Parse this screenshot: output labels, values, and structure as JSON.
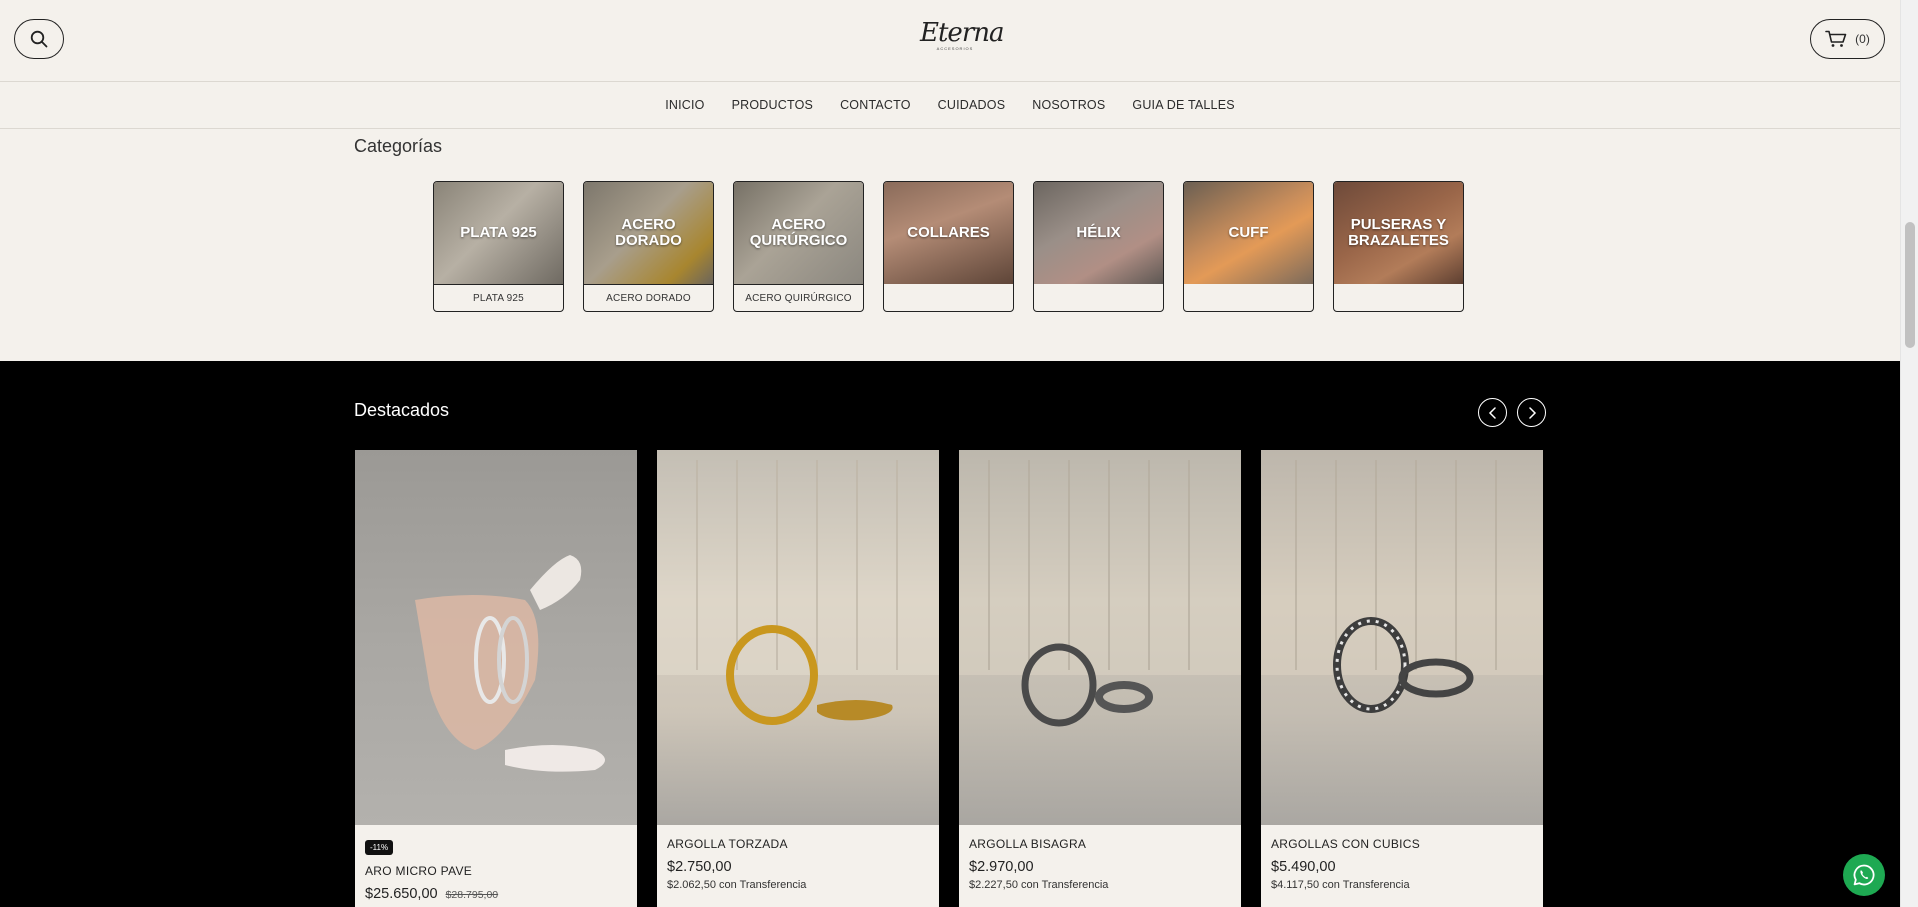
{
  "header": {
    "logo_text": "Eterna",
    "logo_subtext": "ACCESORIOS",
    "cart_count": "(0)"
  },
  "nav": {
    "items": [
      "INICIO",
      "PRODUCTOS",
      "CONTACTO",
      "CUIDADOS",
      "NOSOTROS",
      "GUIA DE TALLES"
    ]
  },
  "categories": {
    "title": "Categorías",
    "items": [
      {
        "image_text": "PLATA 925",
        "label": "PLATA 925"
      },
      {
        "image_text": "ACERO DORADO",
        "label": "ACERO DORADO"
      },
      {
        "image_text": "ACERO QUIRÚRGICO",
        "label": "ACERO QUIRÚRGICO"
      },
      {
        "image_text": "COLLARES",
        "label": ""
      },
      {
        "image_text": "HÉLIX",
        "label": ""
      },
      {
        "image_text": "CUFF",
        "label": ""
      },
      {
        "image_text": "PULSERAS Y BRAZALETES",
        "label": ""
      }
    ]
  },
  "featured": {
    "title": "Destacados",
    "products": [
      {
        "badge": "-11%",
        "name": "ARO MICRO PAVE",
        "price": "$25.650,00",
        "old_price": "$28.795,00",
        "transfer": ""
      },
      {
        "badge": "",
        "name": "ARGOLLA TORZADA",
        "price": "$2.750,00",
        "old_price": "",
        "transfer": "$2.062,50 con Transferencia"
      },
      {
        "badge": "",
        "name": "ARGOLLA BISAGRA",
        "price": "$2.970,00",
        "old_price": "",
        "transfer": "$2.227,50 con Transferencia"
      },
      {
        "badge": "",
        "name": "ARGOLLAS CON CUBICS",
        "price": "$5.490,00",
        "old_price": "",
        "transfer": "$4.117,50 con Transferencia"
      }
    ]
  },
  "colors": {
    "background": "#f4f1ec",
    "featured_bg": "#000000",
    "whatsapp": "#1ea952"
  },
  "icons": [
    "search-icon",
    "cart-icon",
    "chevron-left-icon",
    "chevron-right-icon",
    "whatsapp-icon"
  ]
}
